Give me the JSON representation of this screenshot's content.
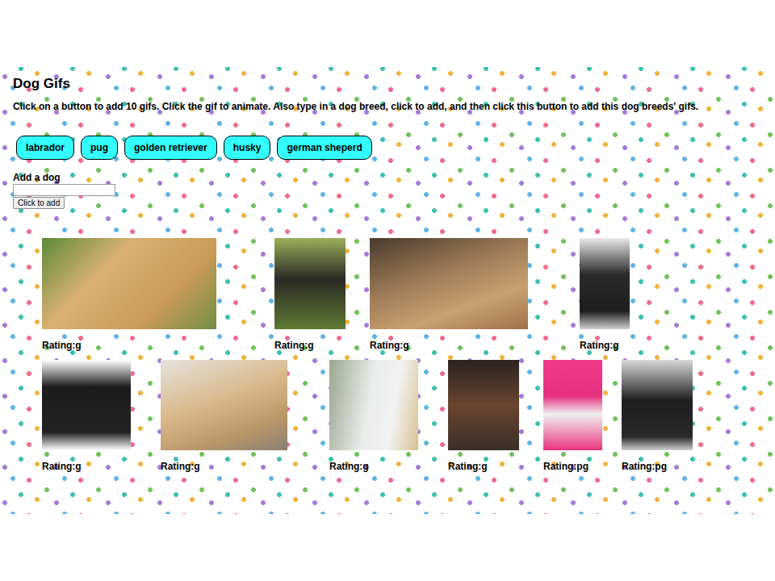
{
  "page": {
    "title": "Dog Gifs",
    "instructions": "Click on a button to add 10 gifs. Click the gif to animate. Also type in a dog breed, click to add, and then click this button to add this dog breeds' gifs."
  },
  "breed_buttons": [
    "labrador",
    "pug",
    "golden retriever",
    "husky",
    "german sheperd"
  ],
  "add_form": {
    "label": "Add a dog",
    "value": "",
    "button": "Click to add"
  },
  "gifs": [
    {
      "caption": "Rating:g"
    },
    {
      "caption": "Rating:g"
    },
    {
      "caption": "Rating:g"
    },
    {
      "caption": "Rating:g"
    },
    {
      "caption": "Rating:g"
    },
    {
      "caption": "Rating:g"
    },
    {
      "caption": "Rating:g"
    },
    {
      "caption": "Rating:g"
    },
    {
      "caption": "Rating:pg"
    },
    {
      "caption": "Rating:pg"
    }
  ]
}
